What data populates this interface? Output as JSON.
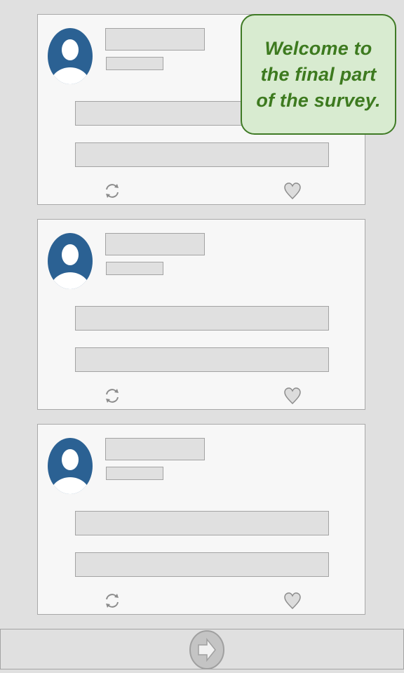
{
  "colors": {
    "page_background": "#e0e0e0",
    "card_background": "#f7f7f7",
    "avatar_blue": "#2b6193",
    "callout_background": "#d8ebd0",
    "callout_border": "#3f7a25",
    "callout_text": "#3d7a1f",
    "icon_gray": "#8c8c8c"
  },
  "feed": {
    "posts": [
      {
        "avatar_icon": "user-avatar-icon",
        "retweet_icon": "retweet-icon",
        "like_icon": "heart-icon"
      },
      {
        "avatar_icon": "user-avatar-icon",
        "retweet_icon": "retweet-icon",
        "like_icon": "heart-icon"
      },
      {
        "avatar_icon": "user-avatar-icon",
        "retweet_icon": "retweet-icon",
        "like_icon": "heart-icon"
      }
    ]
  },
  "callout": {
    "line1": "Welcome to",
    "line2": "the final part",
    "line3": "of the survey."
  },
  "footer": {
    "next_icon": "arrow-right-icon"
  }
}
